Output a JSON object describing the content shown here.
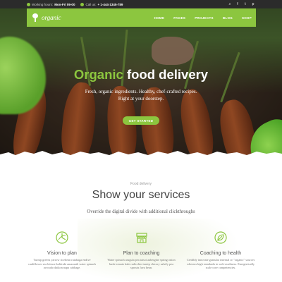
{
  "topbar": {
    "hours_label": "Working hours:",
    "hours_value": "Mon-Fri 09-00",
    "call_label": "Call us:",
    "call_value": "+ 1-444-1345-789",
    "socials": [
      "search-icon",
      "facebook-icon",
      "twitter-icon",
      "pinterest-icon"
    ]
  },
  "nav": {
    "logo_text": "organic",
    "menu": [
      "HOME",
      "PAGES",
      "PROJECTS",
      "BLOG",
      "SHOP"
    ]
  },
  "hero": {
    "title_accent": "Organic",
    "title_rest": " food delivery",
    "subtitle_line1": "Fresh, organic ingredients. Healthy, chef-crafted recipes.",
    "subtitle_line2": "Right at your doorstep.",
    "cta_label": "GET STARTED"
  },
  "services": {
    "eyebrow": "Food delivery",
    "title": "Show your services",
    "subtitle": "Override the digital divide with additional clickthroughs",
    "items": [
      {
        "icon": "plate-icon",
        "title": "Vision to plan",
        "text": "Turnip greens yarrow ricebean rutabaga endive cauliflower sea lettuce kohlrabi amaranth water spinach avocado daikon napa cabbage."
      },
      {
        "icon": "storefront-icon",
        "title": "Plan to coaching",
        "text": "Water spinach arugula pea tatsoi aubergine spring onion bush tomato kale radicchio turnip chicory salsify pea sprouts fava bean."
      },
      {
        "icon": "leaf-icon",
        "title": "Coaching to health",
        "text": "Credibly innovate granular internal or \"organic\" sources whereas high standards in web-readiness. Energistically scale core competencies."
      }
    ]
  },
  "colors": {
    "accent": "#8cc63f",
    "topbar_bg": "#2b2b2b",
    "title_text": "#444444"
  }
}
